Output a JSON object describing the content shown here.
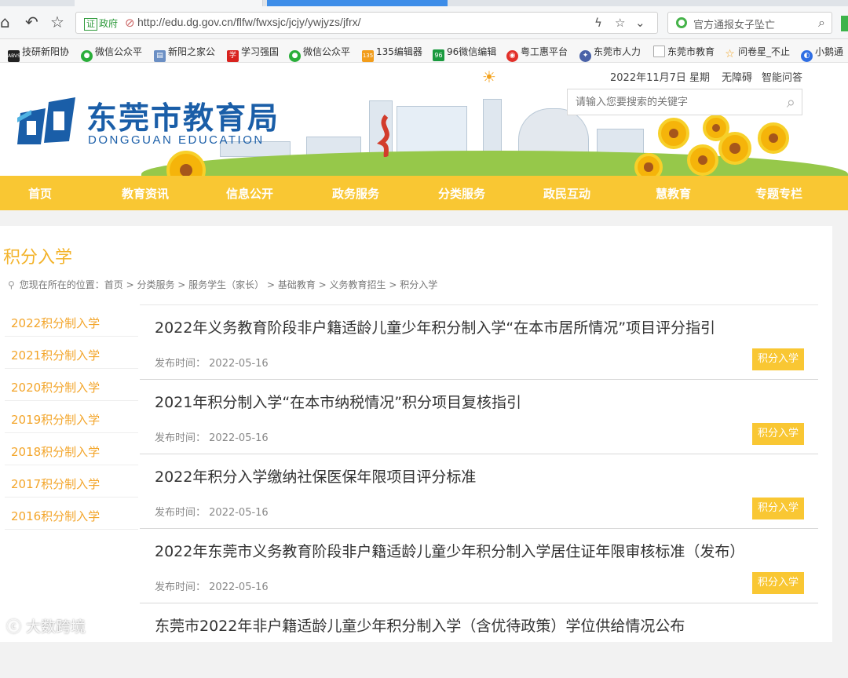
{
  "browser": {
    "url": "http://edu.dg.gov.cn/flfw/fwxsjc/jcjy/ywjyzs/jfrx/",
    "cert_badge": "证",
    "cert_label": "政府",
    "search_text": "官方通报女子坠亡"
  },
  "bookmarks": [
    {
      "label": "技研新阳协",
      "icon": "abvs-icon",
      "color": "#222"
    },
    {
      "label": "微信公众平",
      "icon": "wechat-icon",
      "color": "#2aae3a"
    },
    {
      "label": "新阳之家公",
      "icon": "doc-icon",
      "color": "#6b8fc4"
    },
    {
      "label": "学习强国",
      "icon": "xuexi-icon",
      "color": "#d8231f"
    },
    {
      "label": "微信公众平",
      "icon": "wechat-icon",
      "color": "#2aae3a"
    },
    {
      "label": "135编辑器",
      "icon": "135-icon",
      "color": "#f29d1b"
    },
    {
      "label": "96微信编辑",
      "icon": "96-icon",
      "color": "#1a9a3f"
    },
    {
      "label": "粤工惠平台",
      "icon": "union-icon",
      "color": "#e2302a"
    },
    {
      "label": "东莞市人力",
      "icon": "emblem-icon",
      "color": "#4a62a8"
    },
    {
      "label": "东莞市教育",
      "icon": "page-icon",
      "color": "#999"
    },
    {
      "label": "问卷星_不止",
      "icon": "star-icon",
      "color": "#f0a423"
    },
    {
      "label": "小鹅通",
      "icon": "goose-icon",
      "color": "#2f6ee3"
    }
  ],
  "header": {
    "site_name_cn": "东莞市教育局",
    "site_name_en": "DONGGUAN EDUCATION",
    "date": "2022年11月7日 星期",
    "accessibility": "无障碍",
    "smart_qa": "智能问答",
    "search_placeholder": "请输入您要搜索的关键字"
  },
  "nav": [
    "首页",
    "教育资讯",
    "信息公开",
    "政务服务",
    "分类服务",
    "政民互动",
    "慧教育",
    "专题专栏"
  ],
  "page": {
    "title": "积分入学",
    "breadcrumb": "您现在所在的位置：首页 > 分类服务 > 服务学生（家长） > 基础教育 > 义务教育招生 > 积分入学"
  },
  "sidebar": [
    "2022积分制入学",
    "2021积分制入学",
    "2020积分制入学",
    "2019积分制入学",
    "2018积分制入学",
    "2017积分制入学",
    "2016积分制入学"
  ],
  "articles": [
    {
      "title": "2022年义务教育阶段非户籍适龄儿童少年积分制入学“在本市居所情况”项目评分指引",
      "date_label": "发布时间：",
      "date": "2022-05-16",
      "tag": "积分入学"
    },
    {
      "title": "2021年积分制入学“在本市纳税情况”积分项目复核指引",
      "date_label": "发布时间：",
      "date": "2022-05-16",
      "tag": "积分入学"
    },
    {
      "title": "2022年积分入学缴纳社保医保年限项目评分标准",
      "date_label": "发布时间：",
      "date": "2022-05-16",
      "tag": "积分入学"
    },
    {
      "title": "2022年东莞市义务教育阶段非户籍适龄儿童少年积分制入学居住证年限审核标准（发布）",
      "date_label": "发布时间：",
      "date": "2022-05-16",
      "tag": "积分入学"
    },
    {
      "title": "东莞市2022年非户籍适龄儿童少年积分制入学（含优待政策）学位供给情况公布",
      "date_label": "",
      "date": "",
      "tag": ""
    }
  ],
  "watermark": "大数跨境"
}
